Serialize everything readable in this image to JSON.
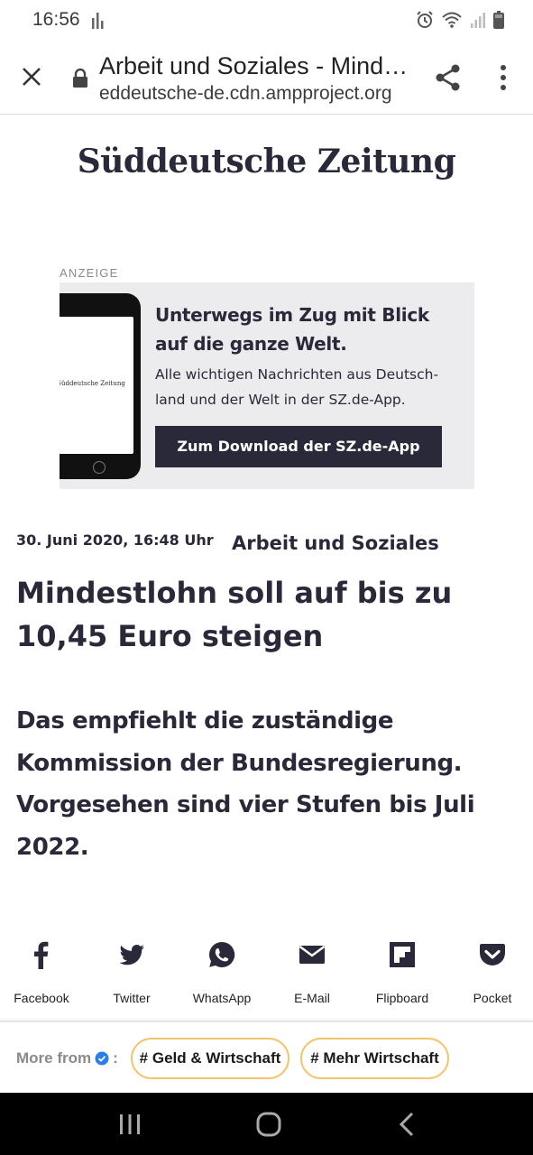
{
  "status_bar": {
    "time": "16:56"
  },
  "browser": {
    "page_title": "Arbeit und Soziales - Mindestlohn soll auf bis zu 10,45 Euro steigen",
    "url": "eddeutsche-de.cdn.ampproject.org"
  },
  "logo": {
    "text": "Süddeutsche Zeitung"
  },
  "ad": {
    "label": "ANZEIGE",
    "headline": "Unterwegs im Zug mit Blick auf die ganze Welt.",
    "text": "Alle wichtigen Nachrichten aus Deutsch-land  und der Welt in der SZ.de-App.",
    "button": "Zum Download der SZ.de-App",
    "phone_logo": "Süddeutsche Zeitung"
  },
  "article": {
    "date": "30. Juni 2020, 16:48 Uhr",
    "topic": "Arbeit und Soziales",
    "title": "Mindestlohn soll auf bis zu 10,45 Euro steigen",
    "teaser": "Das empfiehlt die zuständige Kommission der Bundesregierung. Vorgesehen sind vier Stufen bis Juli 2022."
  },
  "share": {
    "items": [
      {
        "label": "Facebook",
        "icon": "facebook-icon"
      },
      {
        "label": "Twitter",
        "icon": "twitter-icon"
      },
      {
        "label": "WhatsApp",
        "icon": "whatsapp-icon"
      },
      {
        "label": "E-Mail",
        "icon": "mail-icon"
      },
      {
        "label": "Flipboard",
        "icon": "flipboard-icon"
      },
      {
        "label": "Pocket",
        "icon": "pocket-icon"
      }
    ]
  },
  "more_from": {
    "label": "More from",
    "colon": ":",
    "chips": [
      "# Geld & Wirtschaft",
      "# Mehr Wirtschaft"
    ]
  },
  "colors": {
    "text": "#29293a",
    "ad_background": "#ececee",
    "chip_border": "#f4c46b",
    "verified": "#2b7de9"
  }
}
